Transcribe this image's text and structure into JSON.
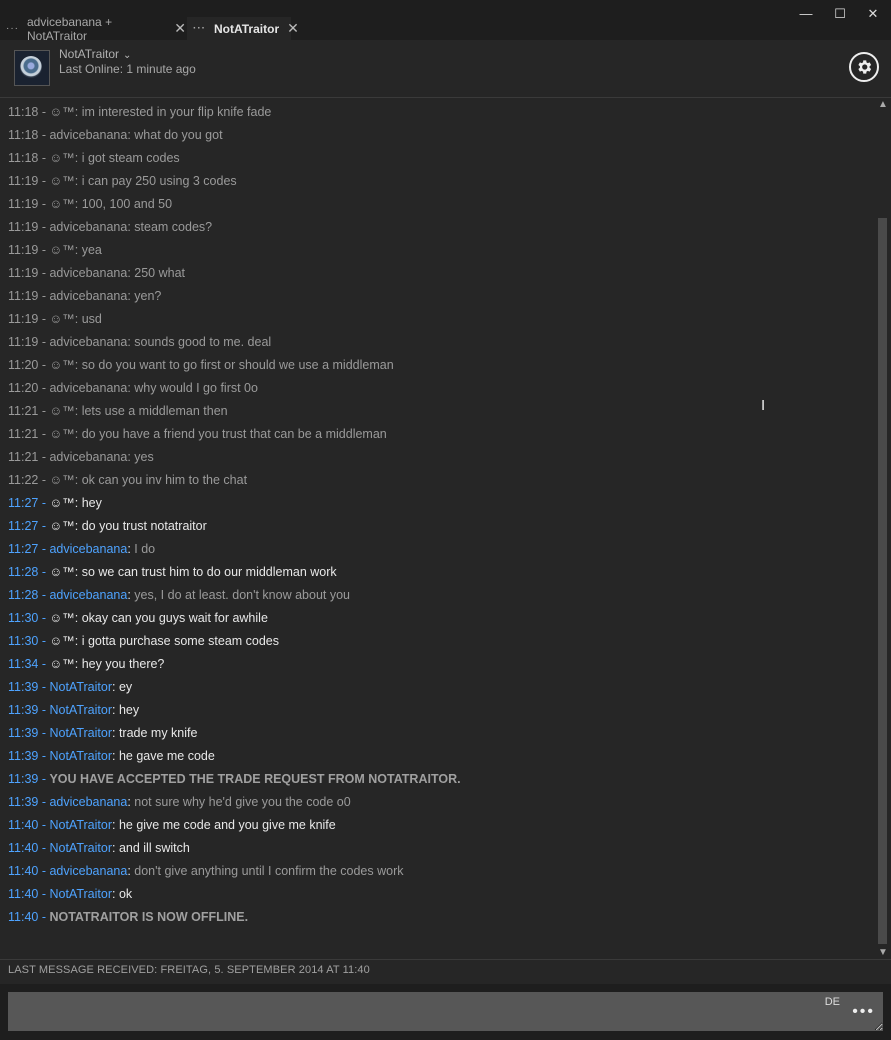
{
  "tabs": [
    {
      "label": "advicebanana + NotATraitor",
      "menu": "···",
      "close": "✕",
      "active": false
    },
    {
      "label": "NotATraitor",
      "menu": "···",
      "close": "✕",
      "active": true
    }
  ],
  "window_controls": {
    "minimize": "—",
    "maximize": "☐",
    "close": "✕"
  },
  "header": {
    "name": "NotATraitor",
    "name_chevron": "⌄",
    "status": "Last Online: 1 minute ago"
  },
  "messages": [
    {
      "time": "11:18",
      "author": "☺™",
      "text": "im interested in your flip knife fade",
      "style": "old"
    },
    {
      "time": "11:18",
      "author": "advicebanana",
      "text": "what do you got",
      "style": "old"
    },
    {
      "time": "11:18",
      "author": "☺™",
      "text": "i got steam codes",
      "style": "old"
    },
    {
      "time": "11:19",
      "author": "☺™",
      "text": "i can pay 250 using 3 codes",
      "style": "old"
    },
    {
      "time": "11:19",
      "author": "☺™",
      "text": "100, 100 and 50",
      "style": "old"
    },
    {
      "time": "11:19",
      "author": "advicebanana",
      "text": "steam codes?",
      "style": "old"
    },
    {
      "time": "11:19",
      "author": "☺™",
      "text": "yea",
      "style": "old"
    },
    {
      "time": "11:19",
      "author": "advicebanana",
      "text": "250 what",
      "style": "old"
    },
    {
      "time": "11:19",
      "author": "advicebanana",
      "text": "yen?",
      "style": "old"
    },
    {
      "time": "11:19",
      "author": "☺™",
      "text": "usd",
      "style": "old"
    },
    {
      "time": "11:19",
      "author": "advicebanana",
      "text": "sounds good to me. deal",
      "style": "old"
    },
    {
      "time": "11:20",
      "author": "☺™",
      "text": "so do you want to go first or should we use a middleman",
      "style": "old"
    },
    {
      "time": "11:20",
      "author": "advicebanana",
      "text": "why would I go first 0o",
      "style": "old"
    },
    {
      "time": "11:21",
      "author": "☺™",
      "text": "lets use a middleman then",
      "style": "old"
    },
    {
      "time": "11:21",
      "author": "☺™",
      "text": "do you have a friend you trust that can be a middleman",
      "style": "old"
    },
    {
      "time": "11:21",
      "author": "advicebanana",
      "text": "yes",
      "style": "old"
    },
    {
      "time": "11:22",
      "author": "☺™",
      "text": "ok can you inv him to the chat",
      "style": "old"
    },
    {
      "time": "11:27",
      "author": "☺™",
      "text": "hey",
      "style": "you"
    },
    {
      "time": "11:27",
      "author": "☺™",
      "text": "do you trust notatraitor",
      "style": "you"
    },
    {
      "time": "11:27",
      "author": "advicebanana",
      "text": "I do",
      "style": "adv"
    },
    {
      "time": "11:28",
      "author": "☺™",
      "text": "so we can trust him to do our middleman work",
      "style": "you"
    },
    {
      "time": "11:28",
      "author": "advicebanana",
      "text": "yes, I do at least. don't know about you",
      "style": "adv"
    },
    {
      "time": "11:30",
      "author": "☺™",
      "text": "okay can you guys wait for awhile",
      "style": "you"
    },
    {
      "time": "11:30",
      "author": "☺™",
      "text": "i gotta purchase some steam codes",
      "style": "you"
    },
    {
      "time": "11:34",
      "author": "☺™",
      "text": "hey you there?",
      "style": "you"
    },
    {
      "time": "11:39",
      "author": "NotATraitor",
      "text": "ey",
      "style": "nat"
    },
    {
      "time": "11:39",
      "author": "NotATraitor",
      "text": "hey",
      "style": "nat"
    },
    {
      "time": "11:39",
      "author": "NotATraitor",
      "text": "trade my knife",
      "style": "nat"
    },
    {
      "time": "11:39",
      "author": "NotATraitor",
      "text": "he gave me code",
      "style": "nat"
    },
    {
      "time": "11:39",
      "author": "",
      "text": "YOU HAVE ACCEPTED THE TRADE REQUEST FROM NOTATRAITOR.",
      "style": "sys"
    },
    {
      "time": "11:39",
      "author": "advicebanana",
      "text": "not sure why he'd give you the code o0",
      "style": "adv"
    },
    {
      "time": "11:40",
      "author": "NotATraitor",
      "text": "he give me code and you give me knife",
      "style": "nat"
    },
    {
      "time": "11:40",
      "author": "NotATraitor",
      "text": "and ill switch",
      "style": "nat"
    },
    {
      "time": "11:40",
      "author": "advicebanana",
      "text": "don't give anything until I confirm the codes work",
      "style": "adv"
    },
    {
      "time": "11:40",
      "author": "NotATraitor",
      "text": "ok",
      "style": "nat"
    },
    {
      "time": "11:40",
      "author": "",
      "text": "NOTATRAITOR IS NOW OFFLINE.",
      "style": "sys"
    }
  ],
  "footer": {
    "last_message": "LAST MESSAGE RECEIVED: FREITAG, 5. SEPTEMBER 2014 AT 11:40"
  },
  "input": {
    "value": "",
    "language": "DE",
    "more": "•••"
  },
  "colors": {
    "accent": "#4ea3ff",
    "background": "#262626",
    "titlebar": "#1e1e1e",
    "input": "#575757"
  }
}
